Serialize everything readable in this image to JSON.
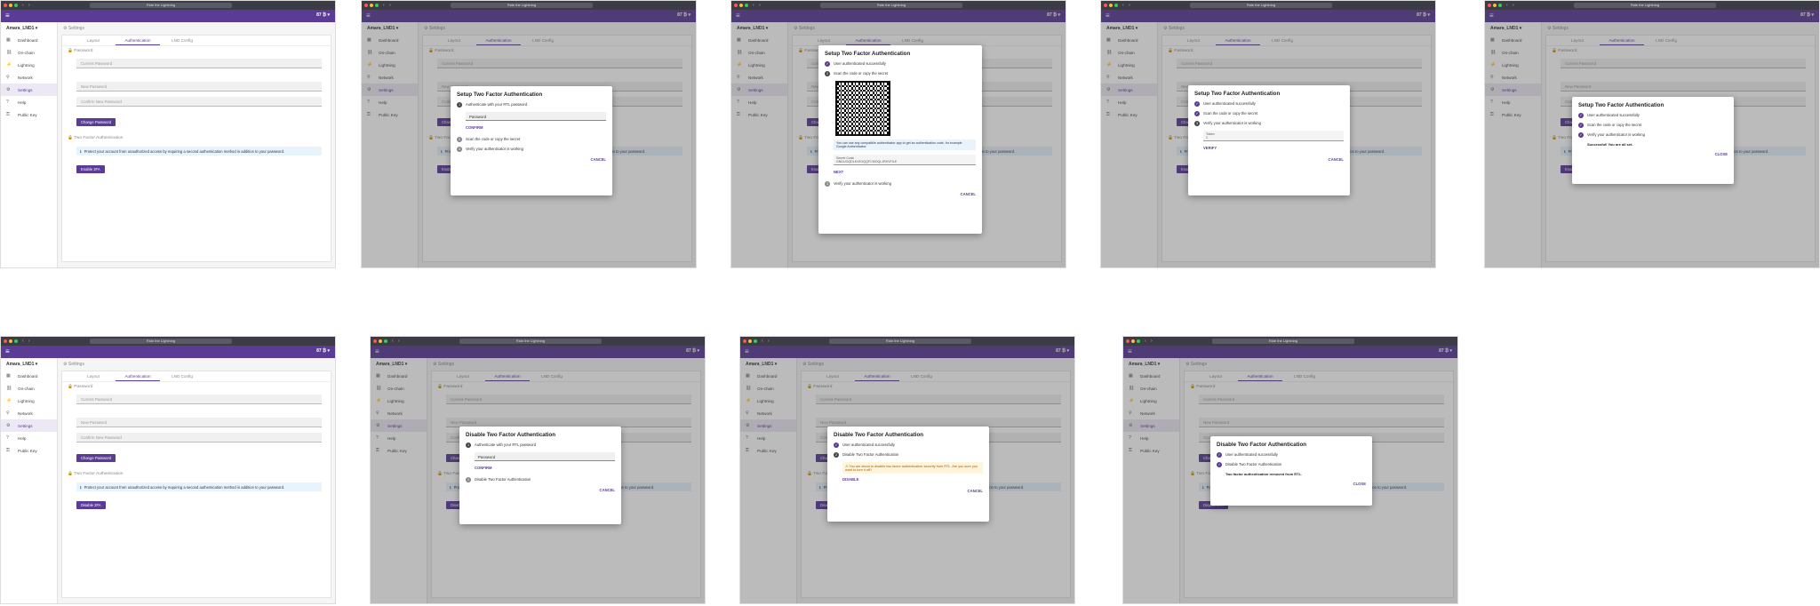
{
  "browser": {
    "url": "Ride the Lightning"
  },
  "app": {
    "balance": "87 ₿",
    "node": "Amara_LND1"
  },
  "nav": [
    "Dashboard",
    "On-chain",
    "Lightning",
    "Network",
    "Settings",
    "Help",
    "Public Key"
  ],
  "page": {
    "crumb": "Settings",
    "tabs": [
      "Layout",
      "Authentication",
      "LND Config"
    ]
  },
  "pw": {
    "section": "Password",
    "current": "Current Password",
    "new": "New Password",
    "confirm": "Confirm New Password",
    "btn": "Change Password"
  },
  "tfa": {
    "section": "Two Factor Authentication",
    "info": "Protect your account from unauthorized access by requiring a second authentication method in addition to your password.",
    "enable": "Enable 2FA",
    "disable": "Disable 2FA"
  },
  "setup": {
    "title": "Setup Two Factor Authentication",
    "s1": "Authenticate with your RTL password",
    "s1done": "User authenticated successfully",
    "pwph": "Password",
    "confirm": "CONFIRM",
    "s2": "Scan the code or copy the secret",
    "s3": "Verify your authenticator is working",
    "cancel": "CANCEL",
    "next": "NEXT",
    "verify": "VERIFY",
    "close": "CLOSE",
    "note": "You can use any compatible authenticator app to get an authentication code, for example Google Authenticator.",
    "secretLabel": "Secret Code",
    "secret": "GNDUOQDLKVEXQQFCMOQLJRKVFILE",
    "tokenLabel": "Token",
    "token": "1",
    "success": "Successful! You are all set."
  },
  "disable": {
    "title": "Disable Two Factor Authentication",
    "s2": "Disable Two Factor Authentication",
    "warn": "You are about to disable two factor authentication security from RTL. Are you sure you want to turn it off?",
    "btn": "DISABLE",
    "success": "Two factor authentication removed from RTL."
  }
}
